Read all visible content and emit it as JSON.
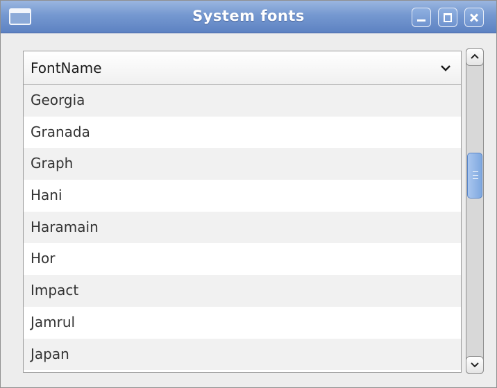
{
  "window": {
    "title": "System fonts",
    "controls": [
      "minimize-icon",
      "maximize-icon",
      "close-icon"
    ]
  },
  "list": {
    "column_header": "FontName",
    "rows": [
      "Georgia",
      "Granada",
      "Graph",
      "Hani",
      "Haramain",
      "Hor",
      "Impact",
      "Jamrul",
      "Japan"
    ]
  },
  "colors": {
    "titlebar": "#7598d0",
    "row_alt": "#f1f1f1",
    "scroll_thumb": "#7fa8e0"
  }
}
